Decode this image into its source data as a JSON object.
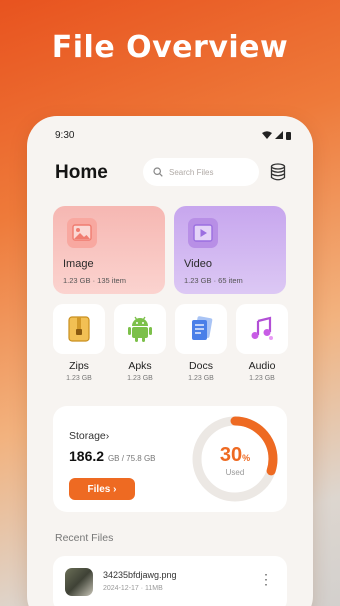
{
  "headline": "File Overview",
  "status": {
    "time": "9:30"
  },
  "header": {
    "title": "Home",
    "search_placeholder": "Search Files"
  },
  "categories": [
    {
      "name": "Image",
      "meta": "1.23 GB · 135 item"
    },
    {
      "name": "Video",
      "meta": "1.23 GB · 65 item"
    }
  ],
  "small_categories": [
    {
      "name": "Zips",
      "size": "1.23 GB"
    },
    {
      "name": "Apks",
      "size": "1.23 GB"
    },
    {
      "name": "Docs",
      "size": "1.23 GB"
    },
    {
      "name": "Audio",
      "size": "1.23 GB"
    }
  ],
  "storage": {
    "label": "Storage›",
    "used": "186.2",
    "total": "GB / 75.8 GB",
    "button": "Files ›",
    "percent": "30",
    "percent_unit": "%",
    "used_label": "Used",
    "fraction": 0.3,
    "accent": "#ee6a22"
  },
  "recent": {
    "title": "Recent Files",
    "items": [
      {
        "name": "34235bfdjawg.png",
        "meta": "2024-12-17 · 11MB"
      }
    ]
  },
  "icons": [
    "search-icon",
    "database-icon",
    "image-icon",
    "video-icon",
    "zip-icon",
    "android-icon",
    "document-icon",
    "music-icon",
    "more-icon"
  ]
}
